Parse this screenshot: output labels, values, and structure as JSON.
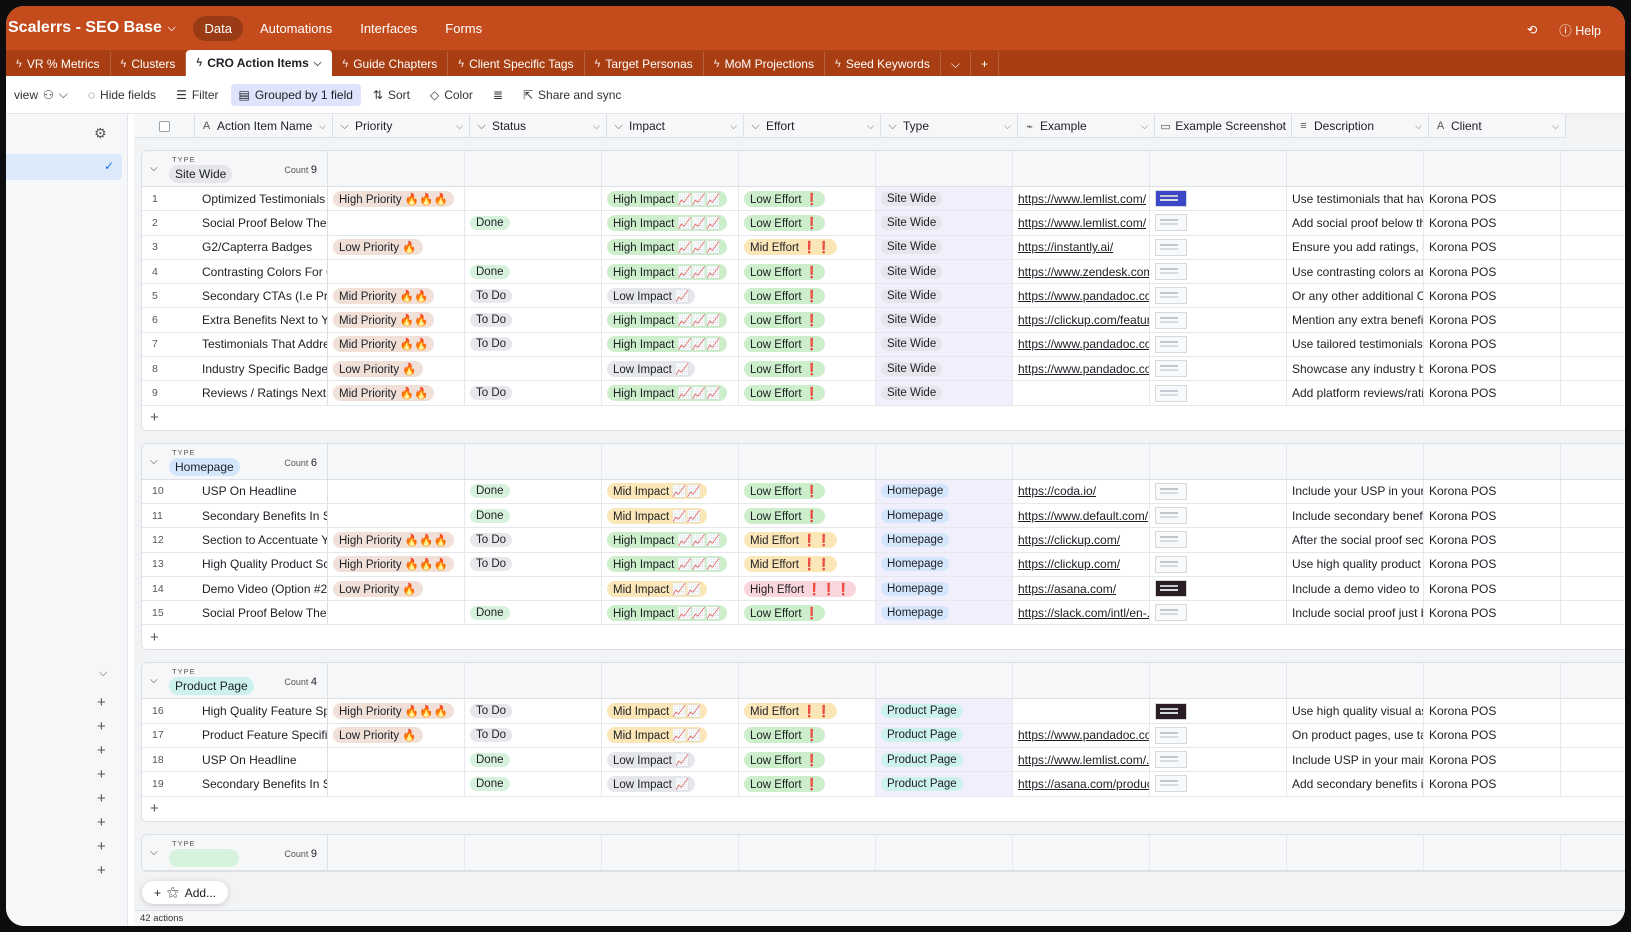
{
  "app": {
    "title": "Scalerrs - SEO Base",
    "nav": [
      "Data",
      "Automations",
      "Interfaces",
      "Forms"
    ],
    "active_nav": "Data",
    "help_label": "Help"
  },
  "tabs": [
    {
      "label": "VR % Metrics",
      "active": false
    },
    {
      "label": "Clusters",
      "active": false
    },
    {
      "label": "CRO Action Items",
      "active": true
    },
    {
      "label": "Guide Chapters",
      "active": false
    },
    {
      "label": "Client Specific Tags",
      "active": false
    },
    {
      "label": "Target Personas",
      "active": false
    },
    {
      "label": "MoM Projections",
      "active": false
    },
    {
      "label": "Seed Keywords",
      "active": false
    }
  ],
  "toolbar": {
    "view_label": "view",
    "hide_fields": "Hide fields",
    "filter": "Filter",
    "grouped": "Grouped by 1 field",
    "sort": "Sort",
    "color": "Color",
    "share": "Share and sync"
  },
  "columns": [
    "Action Item Name",
    "Priority",
    "Status",
    "Impact",
    "Effort",
    "Type",
    "Example",
    "Example Screenshot",
    "Description",
    "Client"
  ],
  "group_label": "TYPE",
  "count_label": "Count",
  "groups": [
    {
      "name": "Site Wide",
      "count": "9",
      "color": "#e4e6ec",
      "rows": [
        [
          "1",
          "Optimized Testimonials",
          "High Priority 🔥🔥🔥",
          "",
          "High Impact 📈📈📈",
          "Low Effort ❗",
          "Site Wide",
          "https://www.lemlist.com/",
          "blue",
          "Use testimonials that have:",
          "Korona POS"
        ],
        [
          "2",
          "Social Proof Below The H...",
          "",
          "Done",
          "High Impact 📈📈📈",
          "Low Effort ❗",
          "Site Wide",
          "https://www.lemlist.com/",
          "light",
          "Add social proof below th...",
          "Korona POS"
        ],
        [
          "3",
          "G2/Capterra Badges",
          "Low Priority 🔥",
          "",
          "High Impact 📈📈📈",
          "Mid Effort ❗❗",
          "Site Wide",
          "https://instantly.ai/",
          "light",
          "Ensure you add ratings, li...",
          "Korona POS"
        ],
        [
          "4",
          "Contrasting Colors For CT...",
          "",
          "Done",
          "High Impact 📈📈📈",
          "Low Effort ❗",
          "Site Wide",
          "https://www.zendesk.com/",
          "light",
          "Use contrasting colors an...",
          "Korona POS"
        ],
        [
          "5",
          "Secondary CTAs (I.e Prici...",
          "Mid Priority 🔥🔥",
          "To Do",
          "Low Impact 📈",
          "Low Effort ❗",
          "Site Wide",
          "https://www.pandadoc.co...",
          "light",
          "Or any other additional C...",
          "Korona POS"
        ],
        [
          "6",
          "Extra Benefits Next to Yo...",
          "Mid Priority 🔥🔥",
          "To Do",
          "High Impact 📈📈📈",
          "Low Effort ❗",
          "Site Wide",
          "https://clickup.com/featur...",
          "light",
          "Mention any extra benefit...",
          "Korona POS"
        ],
        [
          "7",
          "Testimonials That Addres...",
          "Mid Priority 🔥🔥",
          "To Do",
          "High Impact 📈📈📈",
          "Low Effort ❗",
          "Site Wide",
          "https://www.pandadoc.co...",
          "light",
          "Use tailored testimonials ...",
          "Korona POS"
        ],
        [
          "8",
          "Industry Specific Badges",
          "Low Priority 🔥",
          "",
          "Low Impact 📈",
          "Low Effort ❗",
          "Site Wide",
          "https://www.pandadoc.co...",
          "light",
          "Showcase any industry b...",
          "Korona POS"
        ],
        [
          "9",
          "Reviews / Ratings Next To...",
          "Mid Priority 🔥🔥",
          "To Do",
          "High Impact 📈📈📈",
          "Low Effort ❗",
          "Site Wide",
          "",
          "light",
          "Add platform reviews/rati...",
          "Korona POS"
        ]
      ]
    },
    {
      "name": "Homepage",
      "count": "6",
      "color": "#d4e6fb",
      "rows": [
        [
          "10",
          "USP On Headline",
          "",
          "Done",
          "Mid Impact 📈📈",
          "Low Effort ❗",
          "Homepage",
          "https://coda.io/",
          "light",
          "Include your USP in your ...",
          "Korona POS"
        ],
        [
          "11",
          "Secondary Benefits In Su...",
          "",
          "Done",
          "Mid Impact 📈📈",
          "Low Effort ❗",
          "Homepage",
          "https://www.default.com/",
          "light",
          "Include secondary benefi...",
          "Korona POS"
        ],
        [
          "12",
          "Section to Accentuate Yo...",
          "High Priority 🔥🔥🔥",
          "To Do",
          "High Impact 📈📈📈",
          "Mid Effort ❗❗",
          "Homepage",
          "https://clickup.com/",
          "light",
          "After the social proof sec...",
          "Korona POS"
        ],
        [
          "13",
          "High Quality Product Scr...",
          "High Priority 🔥🔥🔥",
          "To Do",
          "High Impact 📈📈📈",
          "Mid Effort ❗❗",
          "Homepage",
          "https://clickup.com/",
          "light",
          "Use high quality product ...",
          "Korona POS"
        ],
        [
          "14",
          "Demo Video (Option #2)",
          "Low Priority 🔥",
          "",
          "Mid Impact 📈📈",
          "High Effort ❗❗❗",
          "Homepage",
          "https://asana.com/",
          "dark",
          "Include a demo video to d...",
          "Korona POS"
        ],
        [
          "15",
          "Social Proof Below The F...",
          "",
          "Done",
          "High Impact 📈📈📈",
          "Low Effort ❗",
          "Homepage",
          "https://slack.com/intl/en-...",
          "light",
          "Include social proof just b...",
          "Korona POS"
        ]
      ]
    },
    {
      "name": "Product Page",
      "count": "4",
      "color": "#ccf1ee",
      "rows": [
        [
          "16",
          "High Quality Feature Spe...",
          "High Priority 🔥🔥🔥",
          "To Do",
          "Mid Impact 📈📈",
          "Mid Effort ❗❗",
          "Product Page",
          "",
          "dark",
          "Use high quality visual as...",
          "Korona POS"
        ],
        [
          "17",
          "Product Feature Specific ...",
          "Low Priority 🔥",
          "To Do",
          "Mid Impact 📈📈",
          "Low Effort ❗",
          "Product Page",
          "https://www.pandadoc.co...",
          "light",
          "On product pages, use tai...",
          "Korona POS"
        ],
        [
          "18",
          "USP On Headline",
          "",
          "Done",
          "Low Impact 📈",
          "Low Effort ❗",
          "Product Page",
          "https://www.lemlist.com/...",
          "light",
          "Include USP in your main ...",
          "Korona POS"
        ],
        [
          "19",
          "Secondary Benefits In Su...",
          "",
          "Done",
          "Low Impact 📈",
          "Low Effort ❗",
          "Product Page",
          "https://asana.com/product",
          "light",
          "Add secondary benefits i...",
          "Korona POS"
        ]
      ]
    },
    {
      "name": "",
      "count": "9",
      "color": "#d7f2dc",
      "rows": []
    }
  ],
  "footer": {
    "actions": "42 actions",
    "add_label": "Add..."
  }
}
